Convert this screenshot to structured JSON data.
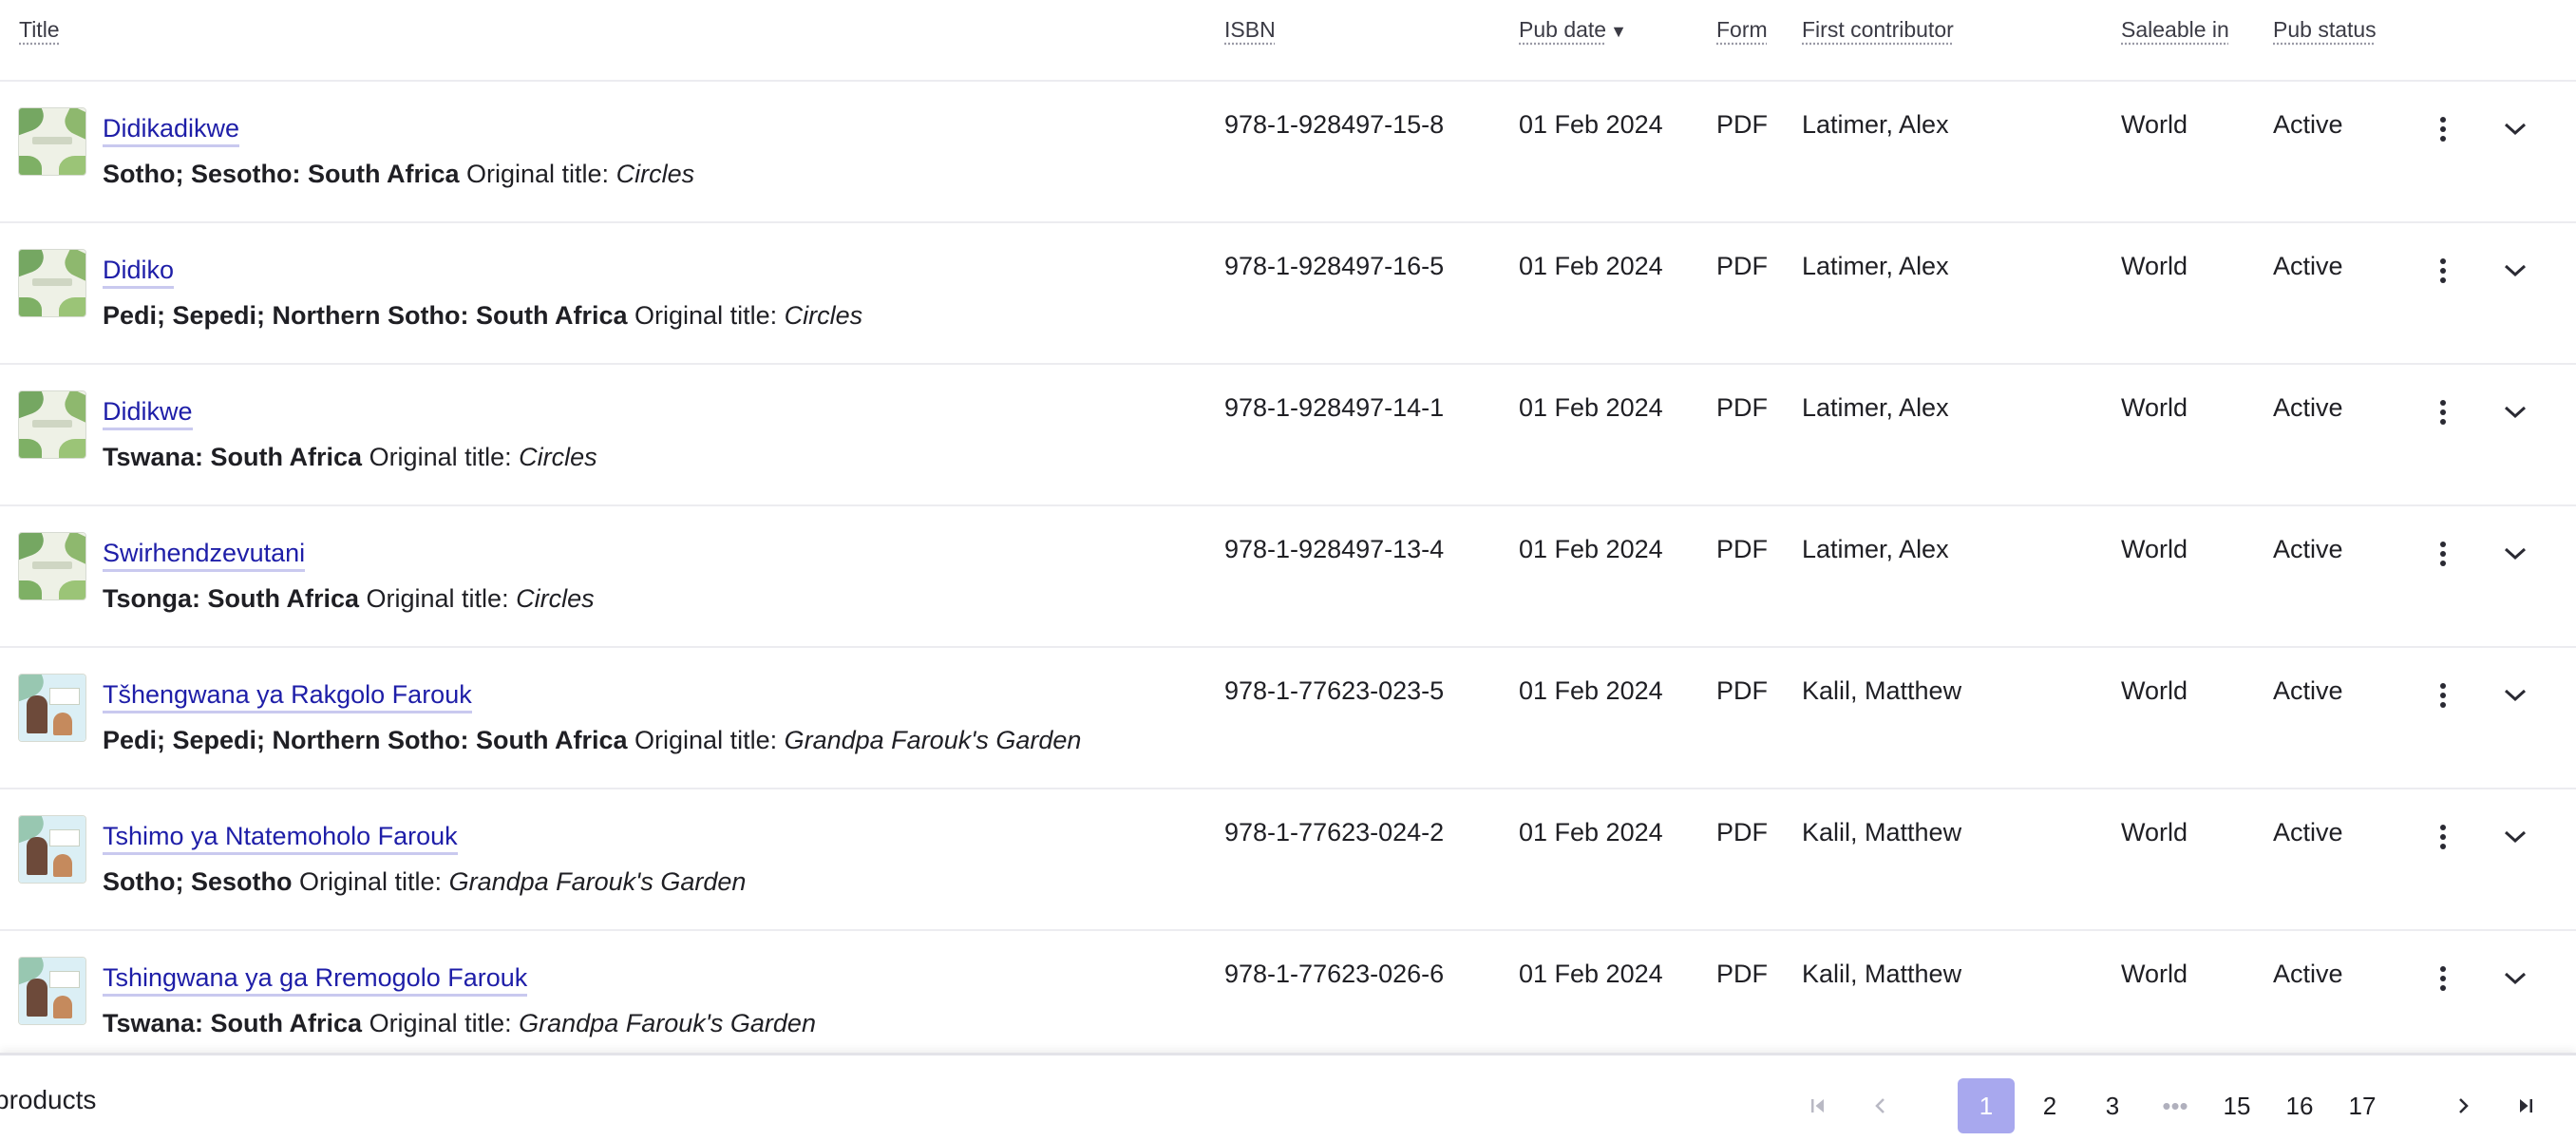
{
  "columns": {
    "title": "Title",
    "isbn": "ISBN",
    "pub_date": "Pub date",
    "pub_date_sort": "▼",
    "form": "Form",
    "first_contributor": "First contributor",
    "saleable_in": "Saleable in",
    "pub_status": "Pub status"
  },
  "rows": [
    {
      "title": "Didikadikwe",
      "language": "Sotho; Sesotho: South Africa",
      "original_title_label": "Original title:",
      "original_title": "Circles",
      "isbn": "978-1-928497-15-8",
      "pub_date": "01 Feb 2024",
      "form": "PDF",
      "contributor": "Latimer, Alex",
      "saleable_in": "World",
      "status": "Active",
      "cover": "circles"
    },
    {
      "title": "Didiko",
      "language": "Pedi; Sepedi; Northern Sotho: South Africa",
      "original_title_label": "Original title:",
      "original_title": "Circles",
      "isbn": "978-1-928497-16-5",
      "pub_date": "01 Feb 2024",
      "form": "PDF",
      "contributor": "Latimer, Alex",
      "saleable_in": "World",
      "status": "Active",
      "cover": "circles"
    },
    {
      "title": "Didikwe",
      "language": "Tswana: South Africa",
      "original_title_label": "Original title:",
      "original_title": "Circles",
      "isbn": "978-1-928497-14-1",
      "pub_date": "01 Feb 2024",
      "form": "PDF",
      "contributor": "Latimer, Alex",
      "saleable_in": "World",
      "status": "Active",
      "cover": "circles"
    },
    {
      "title": "Swirhendzevutani",
      "language": "Tsonga: South Africa",
      "original_title_label": "Original title:",
      "original_title": "Circles",
      "isbn": "978-1-928497-13-4",
      "pub_date": "01 Feb 2024",
      "form": "PDF",
      "contributor": "Latimer, Alex",
      "saleable_in": "World",
      "status": "Active",
      "cover": "circles"
    },
    {
      "title": "Tšhengwana ya Rakgolo Farouk",
      "language": "Pedi; Sepedi; Northern Sotho: South Africa",
      "original_title_label": "Original title:",
      "original_title": "Grandpa Farouk's Garden",
      "isbn": "978-1-77623-023-5",
      "pub_date": "01 Feb 2024",
      "form": "PDF",
      "contributor": "Kalil, Matthew",
      "saleable_in": "World",
      "status": "Active",
      "cover": "garden"
    },
    {
      "title": "Tshimo ya Ntatemoholo Farouk",
      "language": "Sotho; Sesotho",
      "original_title_label": "Original title:",
      "original_title": "Grandpa Farouk's Garden",
      "isbn": "978-1-77623-024-2",
      "pub_date": "01 Feb 2024",
      "form": "PDF",
      "contributor": "Kalil, Matthew",
      "saleable_in": "World",
      "status": "Active",
      "cover": "garden"
    },
    {
      "title": "Tshingwana ya ga Rremogolo Farouk",
      "language": "Tswana: South Africa",
      "original_title_label": "Original title:",
      "original_title": "Grandpa Farouk's Garden",
      "isbn": "978-1-77623-026-6",
      "pub_date": "01 Feb 2024",
      "form": "PDF",
      "contributor": "Kalil, Matthew",
      "saleable_in": "World",
      "status": "Active",
      "cover": "garden"
    }
  ],
  "footer": {
    "products_label": "products",
    "pages": [
      "1",
      "2",
      "3",
      "•••",
      "15",
      "16",
      "17"
    ],
    "current_page": "1"
  },
  "colors": {
    "link": "#1e1ea8",
    "link_underline": "#c9c9ef",
    "active_page": "#a8a8ee",
    "divider": "#ececf0",
    "disabled_icon": "#b9b9c4"
  },
  "icons": {
    "kebab": "vertical-dots-icon",
    "expand": "chevron-down-icon",
    "first_page": "first-page-icon",
    "prev_page": "chevron-left-icon",
    "next_page": "chevron-right-icon",
    "last_page": "last-page-icon"
  }
}
